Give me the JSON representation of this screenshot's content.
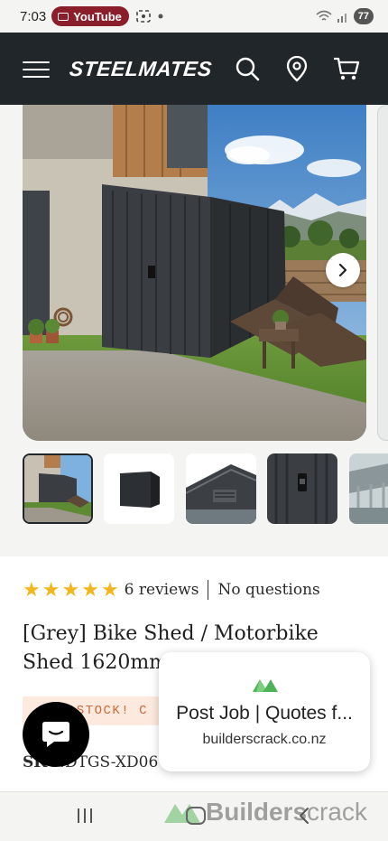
{
  "status_bar": {
    "time": "7:03",
    "youtube_label": "YouTube",
    "battery": "77"
  },
  "header": {
    "logo": "STEELMATES",
    "icons": [
      "menu-icon",
      "search-icon",
      "location-pin-icon",
      "cart-icon"
    ]
  },
  "gallery": {
    "main_image": "dark grey steel bike shed beside a house with mountains and sun loungers",
    "thumbnails": [
      "shed-beside-house",
      "shed-studio-view",
      "shed-roof-closeup",
      "shed-door-handle",
      "shed-interior"
    ],
    "active_index": 0
  },
  "product": {
    "rating_stars": 5,
    "reviews": "6 reviews",
    "questions": "No questions",
    "title": "[Grey] Bike Shed / Motorbike Shed 1620mm x 236",
    "badge": "W STOCK! C",
    "sku_label": "SKU:",
    "sku_value": "DTGS-XD06"
  },
  "ad": {
    "title": "Post Job | Quotes f...",
    "url": "builderscrack.co.nz",
    "banner": "Builderscrack",
    "banner_bold": "Builders",
    "banner_light": "crack"
  },
  "colors": {
    "header_bg": "#21262b",
    "star": "#f3b71d",
    "badge_text": "#cf6a3a",
    "badge_bg": "#fde9dd",
    "youtube_pill": "#8b1e2b"
  }
}
